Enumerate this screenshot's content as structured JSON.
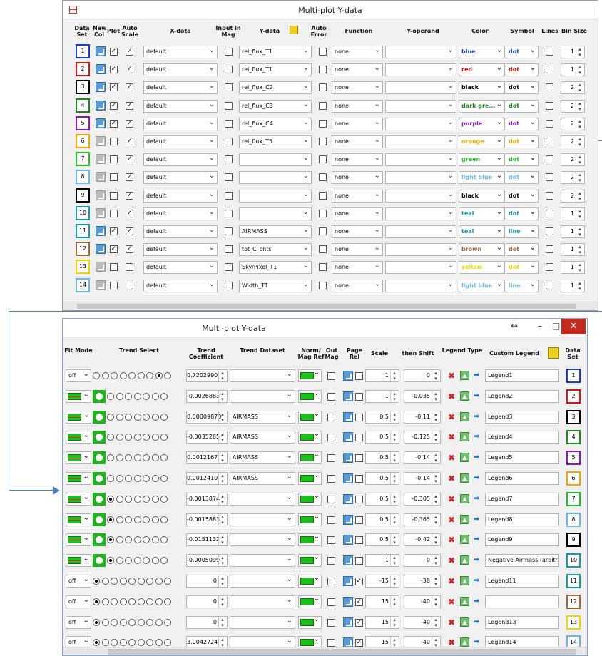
{
  "window1": {
    "title": "Multi-plot Y-data",
    "headers": {
      "dataset": "Data Set",
      "newcol": "New Col",
      "plot": "Plot",
      "autoscale": "Auto Scale",
      "xdata": "X-data",
      "inputmag": "Input in Mag",
      "ydata": "Y-data",
      "autoerror": "Auto Error",
      "function": "Function",
      "yoperand": "Y-operand",
      "color": "Color",
      "symbol": "Symbol",
      "lines": "Lines",
      "binsize": "Bin Size"
    },
    "rows": [
      {
        "n": "1",
        "newcol": true,
        "plot": true,
        "autoscale": true,
        "x": "default",
        "inmag": false,
        "y": "rel_flux_T1",
        "autoerr": false,
        "fn": "none",
        "op": "",
        "color": "blue",
        "colorHex": "#1a3fc8",
        "sym": "dot",
        "lines": false,
        "bin": "1",
        "border": "#1a3fc8"
      },
      {
        "n": "2",
        "newcol": true,
        "plot": true,
        "autoscale": true,
        "x": "default",
        "inmag": false,
        "y": "rel_flux_T1",
        "autoerr": false,
        "fn": "none",
        "op": "",
        "color": "red",
        "colorHex": "#d01818",
        "sym": "dot",
        "lines": false,
        "bin": "1",
        "border": "#d01818"
      },
      {
        "n": "3",
        "newcol": true,
        "plot": true,
        "autoscale": true,
        "x": "default",
        "inmag": false,
        "y": "rel_flux_C2",
        "autoerr": false,
        "fn": "none",
        "op": "",
        "color": "black",
        "colorHex": "#000000",
        "sym": "dot",
        "lines": false,
        "bin": "2",
        "border": "#000000"
      },
      {
        "n": "4",
        "newcol": true,
        "plot": true,
        "autoscale": true,
        "x": "default",
        "inmag": false,
        "y": "rel_flux_C3",
        "autoerr": false,
        "fn": "none",
        "op": "",
        "color": "dark gre...",
        "colorHex": "#1a8a1a",
        "sym": "dot",
        "lines": false,
        "bin": "2",
        "border": "#1a8a1a"
      },
      {
        "n": "5",
        "newcol": true,
        "plot": true,
        "autoscale": true,
        "x": "default",
        "inmag": false,
        "y": "rel_flux_C4",
        "autoerr": false,
        "fn": "none",
        "op": "",
        "color": "purple",
        "colorHex": "#8a1ab8",
        "sym": "dot",
        "lines": false,
        "bin": "2",
        "border": "#8a1ab8"
      },
      {
        "n": "6",
        "newcol": false,
        "plot": false,
        "autoscale": true,
        "x": "default",
        "inmag": false,
        "y": "rel_flux_T5",
        "autoerr": false,
        "fn": "none",
        "op": "",
        "color": "orange",
        "colorHex": "#f0a800",
        "sym": "dot",
        "lines": false,
        "bin": "2",
        "border": "#f0a800"
      },
      {
        "n": "7",
        "newcol": false,
        "plot": false,
        "autoscale": true,
        "x": "default",
        "inmag": false,
        "y": "",
        "autoerr": false,
        "fn": "none",
        "op": "",
        "color": "green",
        "colorHex": "#22c022",
        "sym": "dot",
        "lines": false,
        "bin": "2",
        "border": "#22c022"
      },
      {
        "n": "8",
        "newcol": false,
        "plot": false,
        "autoscale": true,
        "x": "default",
        "inmag": false,
        "y": "",
        "autoerr": false,
        "fn": "none",
        "op": "",
        "color": "light blue",
        "colorHex": "#6ab8e8",
        "sym": "dot",
        "lines": false,
        "bin": "2",
        "border": "#6ab8e8"
      },
      {
        "n": "9",
        "newcol": false,
        "plot": false,
        "autoscale": true,
        "x": "default",
        "inmag": false,
        "y": "",
        "autoerr": false,
        "fn": "none",
        "op": "",
        "color": "black",
        "colorHex": "#000000",
        "sym": "dot",
        "lines": false,
        "bin": "2",
        "border": "#000000"
      },
      {
        "n": "10",
        "newcol": false,
        "plot": false,
        "autoscale": true,
        "x": "default",
        "inmag": false,
        "y": "",
        "autoerr": false,
        "fn": "none",
        "op": "",
        "color": "teal",
        "colorHex": "#1a9aa8",
        "sym": "dot",
        "lines": false,
        "bin": "1",
        "border": "#1a9aa8"
      },
      {
        "n": "11",
        "newcol": true,
        "plot": true,
        "autoscale": true,
        "x": "default",
        "inmag": false,
        "y": "AIRMASS",
        "autoerr": false,
        "fn": "none",
        "op": "",
        "color": "teal",
        "colorHex": "#1a9aa8",
        "sym": "line",
        "lines": false,
        "bin": "1",
        "border": "#1a9aa8"
      },
      {
        "n": "12",
        "newcol": true,
        "plot": true,
        "autoscale": true,
        "x": "default",
        "inmag": false,
        "y": "tot_C_cnts",
        "autoerr": false,
        "fn": "none",
        "op": "",
        "color": "brown",
        "colorHex": "#9a6a3a",
        "sym": "dot",
        "lines": false,
        "bin": "1",
        "border": "#9a6a3a"
      },
      {
        "n": "13",
        "newcol": false,
        "plot": false,
        "autoscale": false,
        "x": "default",
        "inmag": false,
        "y": "Sky/Pixel_T1",
        "autoerr": false,
        "fn": "none",
        "op": "",
        "color": "yellow",
        "colorHex": "#e8d800",
        "sym": "dot",
        "lines": false,
        "bin": "1",
        "border": "#e8d800"
      },
      {
        "n": "14",
        "newcol": false,
        "plot": false,
        "autoscale": false,
        "x": "default",
        "inmag": false,
        "y": "Width_T1",
        "autoerr": false,
        "fn": "none",
        "op": "",
        "color": "light blue",
        "colorHex": "#6ab8e8",
        "sym": "line",
        "lines": false,
        "bin": "1",
        "border": "#6ab8e8"
      }
    ]
  },
  "window2": {
    "title": "Multi-plot Y-data",
    "controls": {
      "resize": "↔",
      "minimize": "–",
      "maximize": "□",
      "close": "✕"
    },
    "headers": {
      "fitmode": "Fit Mode",
      "trendselect": "Trend Select",
      "trendcoef": "Trend Coefficient",
      "trenddataset": "Trend Dataset",
      "normmagref": "Norm/ Mag Ref",
      "outmag": "Out Mag",
      "pagerel": "Page Rel",
      "scale": "Scale",
      "shift": "then Shift",
      "legendtype": "Legend Type",
      "customlegend": "Custom Legend",
      "dataset": "Data Set"
    },
    "rows": [
      {
        "fit": "off",
        "fitGreen": false,
        "green": false,
        "radioOn": 7,
        "coef": "0.7202990",
        "tds": "",
        "pagerel": false,
        "scale": "1",
        "shift": "0",
        "legend": "Legend1",
        "n": "1",
        "border": "#1a3fc8"
      },
      {
        "fit": "",
        "fitGreen": true,
        "green": true,
        "radioOn": 7,
        "coef": "-0.0026883",
        "tds": "",
        "pagerel": false,
        "scale": "1",
        "shift": "-0.035",
        "legend": "Legend2",
        "n": "2",
        "border": "#d01818"
      },
      {
        "fit": "",
        "fitGreen": true,
        "green": true,
        "radioOn": -1,
        "coef": "0.00009870",
        "tds": "AIRMASS",
        "pagerel": false,
        "scale": "0.5",
        "shift": "-0.11",
        "legend": "Legend3",
        "n": "3",
        "border": "#000000"
      },
      {
        "fit": "",
        "fitGreen": true,
        "green": true,
        "radioOn": -1,
        "coef": "-0.0035285",
        "tds": "AIRMASS",
        "pagerel": false,
        "scale": "0.5",
        "shift": "-0.125",
        "legend": "Legend4",
        "n": "4",
        "border": "#1a8a1a"
      },
      {
        "fit": "",
        "fitGreen": true,
        "green": true,
        "radioOn": -1,
        "coef": "0.0012167",
        "tds": "AIRMASS",
        "pagerel": false,
        "scale": "0.5",
        "shift": "-0.14",
        "legend": "Legend5",
        "n": "5",
        "border": "#8a1ab8"
      },
      {
        "fit": "",
        "fitGreen": true,
        "green": true,
        "radioOn": -1,
        "coef": "0.0012410",
        "tds": "AIRMASS",
        "pagerel": false,
        "scale": "0.5",
        "shift": "-0.14",
        "legend": "Legend6",
        "n": "6",
        "border": "#f0a800"
      },
      {
        "fit": "",
        "fitGreen": true,
        "green": true,
        "radioOn": 0,
        "coef": "-0.0013874",
        "tds": "",
        "pagerel": false,
        "scale": "0.5",
        "shift": "-0.305",
        "legend": "Legend7",
        "n": "7",
        "border": "#22c022"
      },
      {
        "fit": "",
        "fitGreen": true,
        "green": true,
        "radioOn": 0,
        "coef": "-0.0015883",
        "tds": "",
        "pagerel": false,
        "scale": "0.5",
        "shift": "-0.365",
        "legend": "Legend8",
        "n": "8",
        "border": "#6ab8e8"
      },
      {
        "fit": "",
        "fitGreen": true,
        "green": true,
        "radioOn": 0,
        "coef": "-0.0151132",
        "tds": "",
        "pagerel": false,
        "scale": "0.5",
        "shift": "-0.42",
        "legend": "Legend9",
        "n": "9",
        "border": "#000000"
      },
      {
        "fit": "",
        "fitGreen": true,
        "green": true,
        "radioOn": 0,
        "coef": "-0.0005099",
        "tds": "",
        "pagerel": false,
        "scale": "1",
        "shift": "0",
        "legend": "Negative Airmass (arbitrarily",
        "n": "10",
        "border": "#1a9aa8"
      },
      {
        "fit": "off",
        "fitGreen": false,
        "green": false,
        "radioOn": 0,
        "coef": "0",
        "tds": "",
        "pagerel": true,
        "scale": "-15",
        "shift": "-38",
        "legend": "Legend11",
        "n": "11",
        "border": "#1a9aa8"
      },
      {
        "fit": "off",
        "fitGreen": false,
        "green": false,
        "radioOn": 0,
        "coef": "0",
        "tds": "",
        "pagerel": true,
        "scale": "15",
        "shift": "-40",
        "legend": "",
        "n": "12",
        "border": "#9a6a3a"
      },
      {
        "fit": "off",
        "fitGreen": false,
        "green": false,
        "radioOn": 0,
        "coef": "0",
        "tds": "",
        "pagerel": true,
        "scale": "15",
        "shift": "-40",
        "legend": "Legend13",
        "n": "13",
        "border": "#e8d800"
      },
      {
        "fit": "off",
        "fitGreen": false,
        "green": false,
        "radioOn": 0,
        "coef": "3.0042724",
        "tds": "",
        "pagerel": true,
        "scale": "15",
        "shift": "-40",
        "legend": "Legend14",
        "n": "14",
        "border": "#6ab8e8"
      }
    ]
  }
}
